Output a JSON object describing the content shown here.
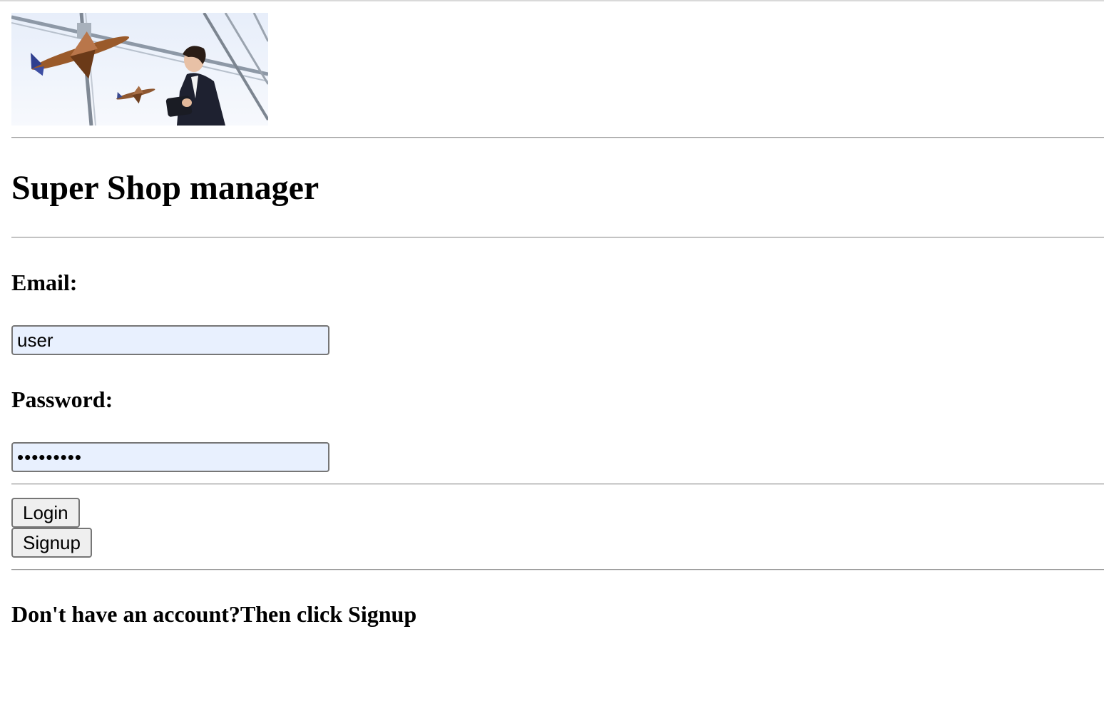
{
  "header": {
    "banner_alt": "",
    "title": "Super Shop manager"
  },
  "login_form": {
    "email_label": "Email:",
    "email_value": "user",
    "password_label": "Password:",
    "password_value": "password1",
    "login_label": "Login",
    "signup_label": "Signup"
  },
  "footer": {
    "note": "Don't have an account?Then click Signup"
  },
  "colors": {
    "input_autofill_bg": "#e8f0fe",
    "button_bg": "#efefef",
    "rule": "#9a9a9a"
  }
}
